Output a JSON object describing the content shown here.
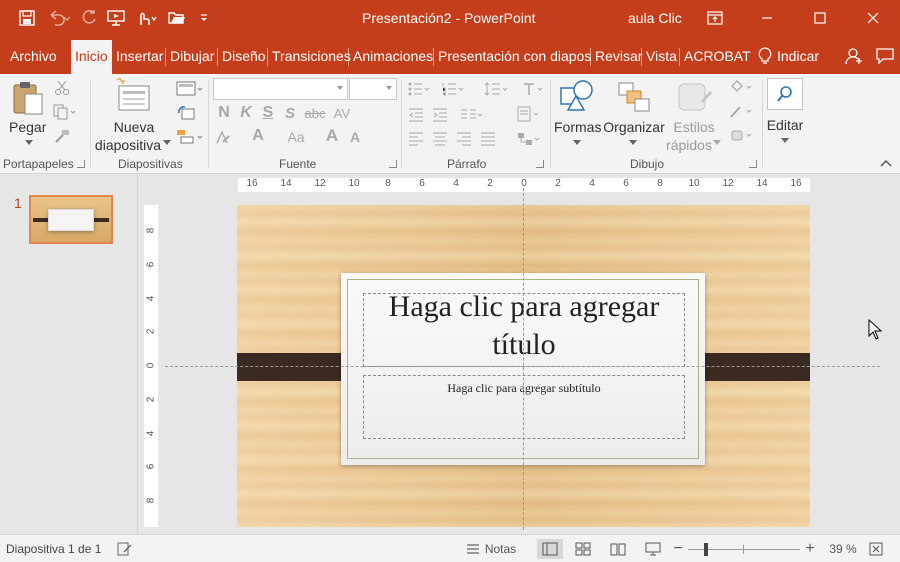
{
  "titlebar": {
    "doc_title": "Presentación2  -  PowerPoint",
    "user": "aula Clic",
    "qat": [
      "save-icon",
      "undo-icon",
      "redo-icon",
      "present-icon",
      "touch-mode-icon",
      "open-icon",
      "customize-qat-icon"
    ],
    "window_buttons": [
      "ribbon-display-icon",
      "minimize-icon",
      "maximize-icon",
      "close-icon"
    ],
    "bar_color": "#c43e1c"
  },
  "tabs": {
    "file": "Archivo",
    "home": "Inicio",
    "insert": "Insertar",
    "draw": "Dibujar",
    "design": "Diseño",
    "transitions": "Transiciones",
    "animations": "Animaciones",
    "slideshow": "Presentación con diapos",
    "review": "Revisar",
    "view": "Vista",
    "acrobat": "ACROBAT",
    "tellme": "Indicar",
    "active": "Inicio"
  },
  "ribbon": {
    "paste": "Pegar",
    "new_slide_1": "Nueva",
    "new_slide_2": "diapositiva",
    "shapes": "Formas",
    "arrange": "Organizar",
    "quick_styles_1": "Estilos",
    "quick_styles_2": "rápidos",
    "editing": "Editar",
    "groups": {
      "clipboard": "Portapapeles",
      "slides": "Diapositivas",
      "font": "Fuente",
      "paragraph": "Párrafo",
      "drawing": "Dibujo"
    },
    "font_buttons": {
      "bold": "N",
      "italic": "K",
      "underline": "S",
      "increase": "A",
      "decrease": "A",
      "case": "Aa"
    },
    "font_name": "",
    "font_size": ""
  },
  "thumbnails": {
    "number": "1"
  },
  "ruler": {
    "h_labels": [
      "16",
      "14",
      "12",
      "10",
      "8",
      "6",
      "4",
      "2",
      "0",
      "2",
      "4",
      "6",
      "8",
      "10",
      "12",
      "14",
      "16"
    ],
    "v_labels": [
      "8",
      "6",
      "4",
      "2",
      "0",
      "2",
      "4",
      "6",
      "8"
    ]
  },
  "slide": {
    "title_placeholder": "Haga clic para agregar título",
    "subtitle_placeholder": "Haga clic para agregar subtítulo"
  },
  "statusbar": {
    "slide_info": "Diapositiva 1 de 1",
    "notes": "Notas",
    "zoom_minus": "−",
    "zoom_plus": "+",
    "zoom": "39 %",
    "zoom_percent": 39
  }
}
